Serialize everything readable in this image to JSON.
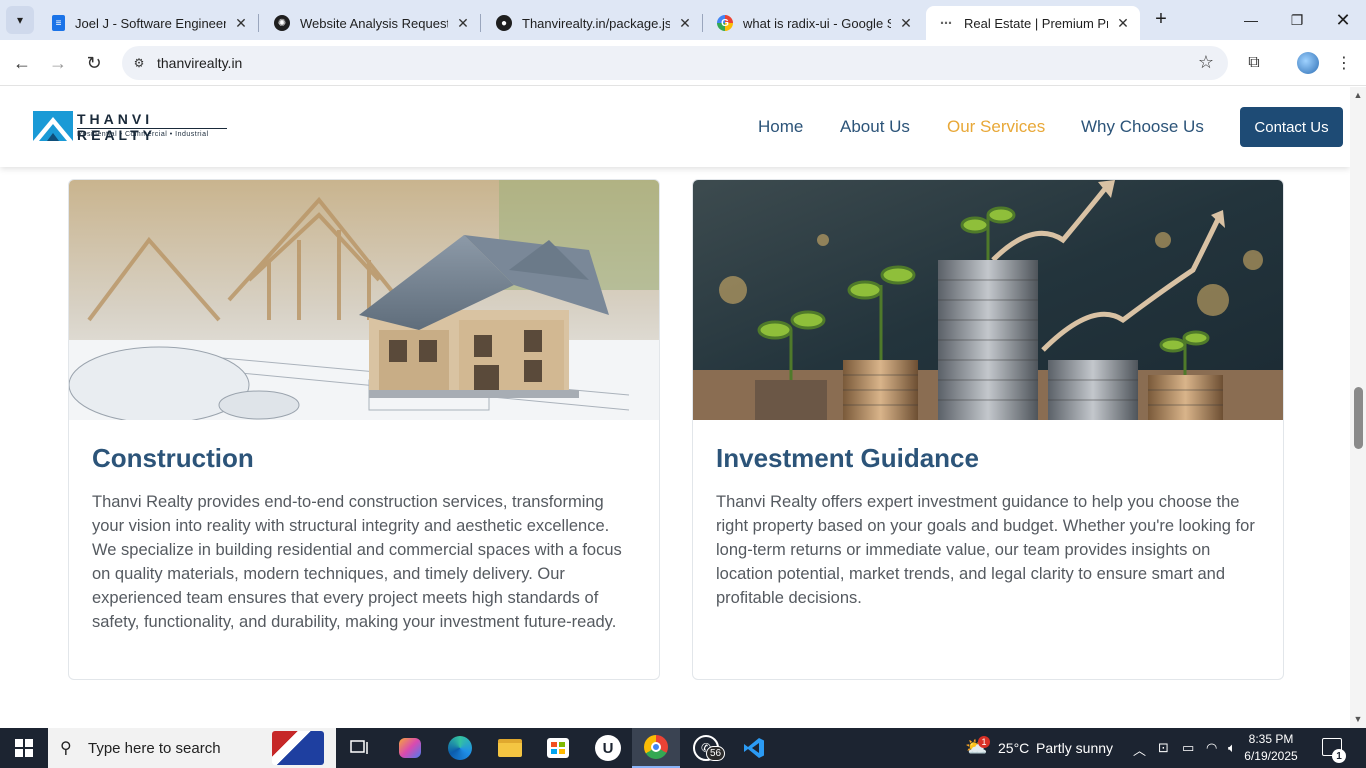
{
  "browser": {
    "tabs": [
      {
        "title": "Joel J - Software Engineer",
        "icon": "document-icon"
      },
      {
        "title": "Website Analysis Request",
        "icon": "openai-icon"
      },
      {
        "title": "Thanvirealty.in/package.json",
        "icon": "github-icon"
      },
      {
        "title": "what is radix-ui - Google Search",
        "icon": "google-icon"
      },
      {
        "title": "Real Estate | Premium Properties",
        "icon": "loading-icon"
      }
    ],
    "address": "thanvirealty.in"
  },
  "site": {
    "logo": {
      "name": "THANVI REALTY",
      "tagline": "Residential • Commercial • Industrial"
    },
    "nav": [
      "Home",
      "About Us",
      "Our Services",
      "Why Choose Us"
    ],
    "nav_active": "Our Services",
    "contact_label": "Contact Us",
    "accent_color": "#e8a838",
    "primary_color": "#2c5479"
  },
  "services": [
    {
      "title": "Construction",
      "image": "house-model-blueprint-photo",
      "text": "Thanvi Realty provides end-to-end construction services, transforming your vision into reality with structural integrity and aesthetic excellence. We specialize in building residential and commercial spaces with a focus on quality materials, modern techniques, and timely delivery. Our experienced team ensures that every project meets high standards of safety, functionality, and durability, making your investment future-ready."
    },
    {
      "title": "Investment Guidance",
      "image": "coins-growth-photo",
      "text": "Thanvi Realty offers expert investment guidance to help you choose the right property based on your goals and budget. Whether you're looking for long-term returns or immediate value, our team provides insights on location potential, market trends, and legal clarity to ensure smart and profitable decisions."
    }
  ],
  "taskbar": {
    "search_placeholder": "Type here to search",
    "whatsapp_badge": "56",
    "weather": {
      "temp": "25°C",
      "condition": "Partly sunny",
      "badge": "1"
    },
    "time": "8:35 PM",
    "date": "6/19/2025",
    "notification_count": "1"
  }
}
